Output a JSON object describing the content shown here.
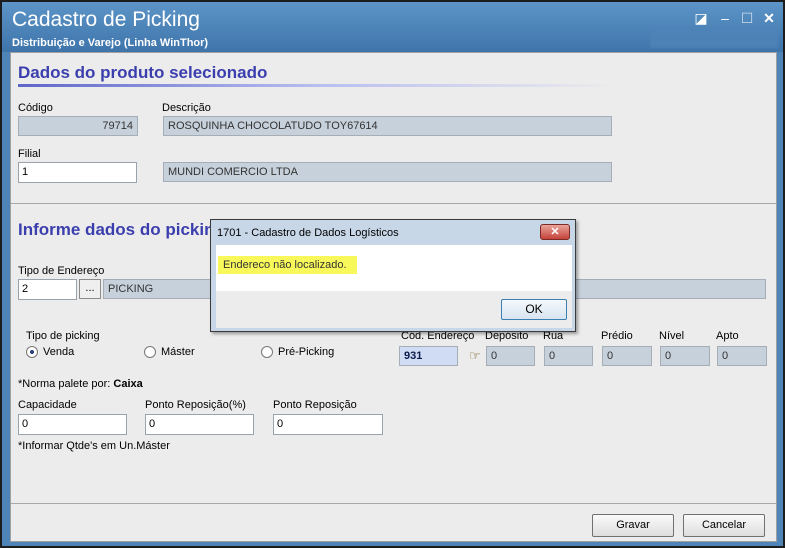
{
  "window": {
    "title": "Cadastro de Picking",
    "subtitle": "Distribuição e Varejo (Linha WinThor)"
  },
  "produto": {
    "section_title": "Dados do produto selecionado",
    "codigo_label": "Código",
    "codigo_value": "79714",
    "descricao_label": "Descrição",
    "descricao_value": "ROSQUINHA CHOCOLATUDO TOY67614",
    "filial_label": "Filial",
    "filial_value": "1",
    "filial_nome": "MUNDI COMERCIO LTDA"
  },
  "picking": {
    "section_title": "Informe dados do picking",
    "tipo_endereco_label": "Tipo de Endereço",
    "tipo_endereco_value": "2",
    "tipo_endereco_button": "...",
    "tipo_endereco_desc": "PICKING",
    "tipo_picking_label": "Tipo de picking",
    "radio_venda": "Venda",
    "radio_master": "Máster",
    "radio_prepicking": "Pré-Picking",
    "cod_endereco_label": "Cód. Endereço",
    "cod_endereco_value": "931",
    "deposito_label": "Depósito",
    "deposito_value": "0",
    "rua_label": "Rua",
    "rua_value": "0",
    "predio_label": "Prédio",
    "predio_value": "0",
    "nivel_label": "Nível",
    "nivel_value": "0",
    "apto_label": "Apto",
    "apto_value": "0",
    "norma_prefix": "*Norma palete por: ",
    "norma_value": "Caixa",
    "capacidade_label": "Capacidade",
    "capacidade_value": "0",
    "ponto_rep_pct_label": "Ponto Reposição(%)",
    "ponto_rep_pct_value": "0",
    "ponto_rep_label": "Ponto Reposição",
    "ponto_rep_value": "0",
    "nota": "*Informar Qtde's em Un.Máster"
  },
  "buttons": {
    "gravar": "Gravar",
    "cancelar": "Cancelar"
  },
  "dialog": {
    "title": "1701 - Cadastro de Dados Logísticos",
    "message": "Endereco não localizado.",
    "ok": "OK"
  }
}
